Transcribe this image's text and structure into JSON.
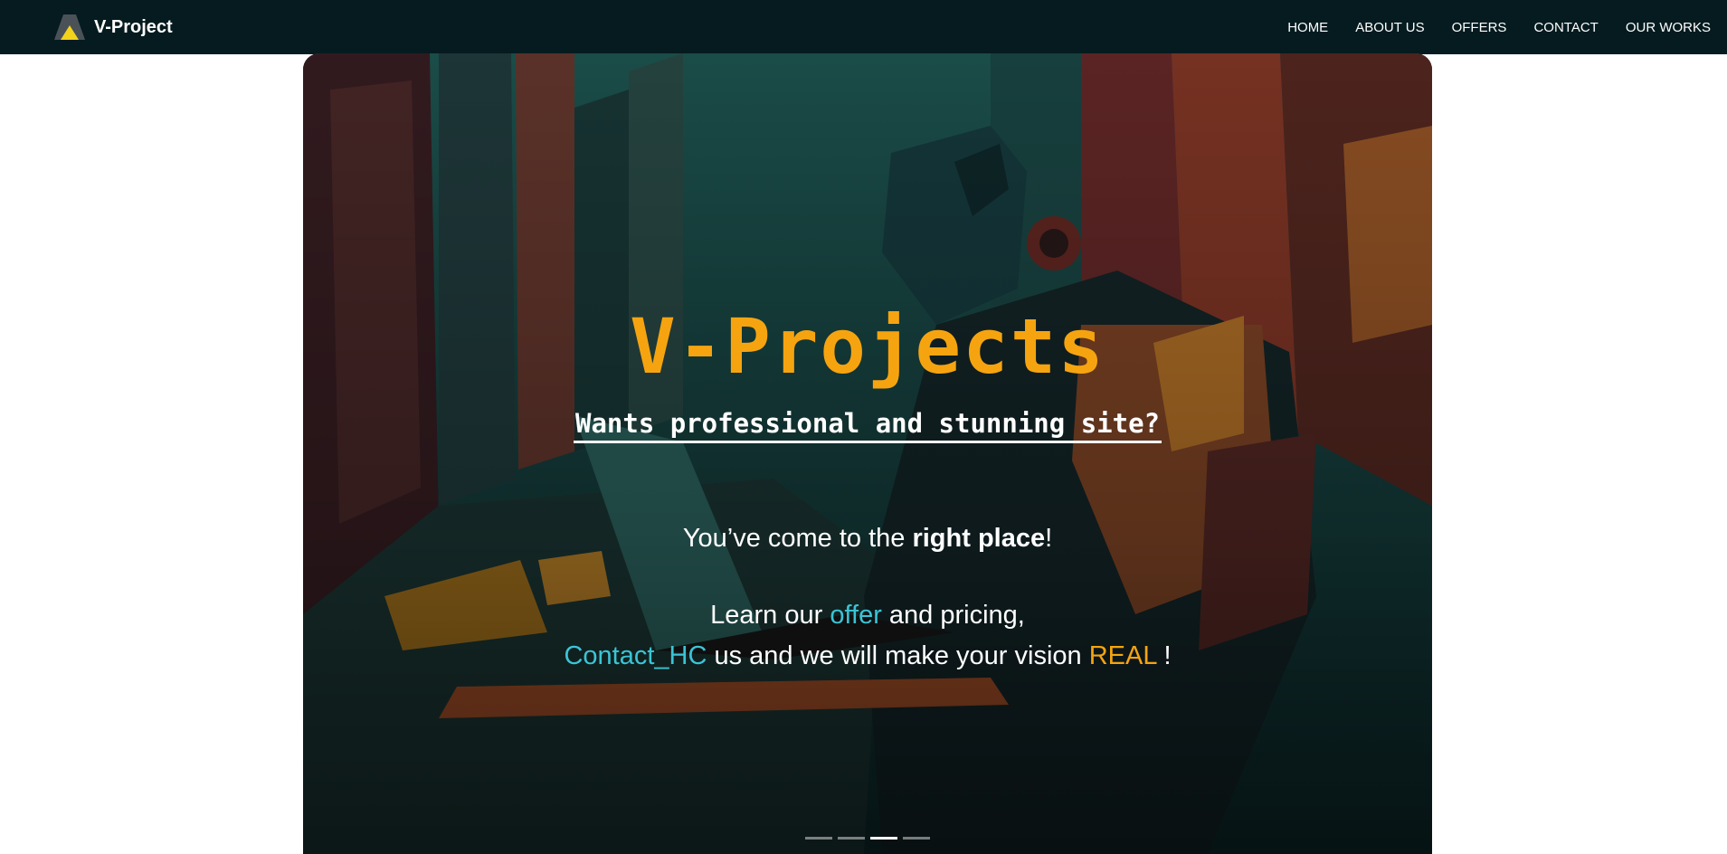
{
  "navbar": {
    "brand": "V-Project",
    "links": [
      "HOME",
      "ABOUT US",
      "OFFERS",
      "CONTACT",
      "OUR WORKS"
    ]
  },
  "hero": {
    "title": "V-Projects",
    "subtitle": "Wants professional and stunning site?",
    "line1": {
      "prefix": "You’ve come to the ",
      "strong": "right place",
      "suffix": "!"
    },
    "line2": {
      "prefix": "Learn our ",
      "link": "offer",
      "suffix": " and pricing,"
    },
    "line3": {
      "link": "Contact_HC",
      "middle": " us and we will make your vision ",
      "accent": "REAL",
      "suffix": " !"
    },
    "carousel": {
      "slides": 4,
      "active_index": 2
    }
  },
  "colors": {
    "navbar_bg": "#051b1f",
    "title_orange": "#f5a410",
    "link_cyan": "#3bc4d6",
    "text_white": "#ffffff"
  },
  "icons": {
    "brand_logo": "triangle-logo-icon"
  }
}
